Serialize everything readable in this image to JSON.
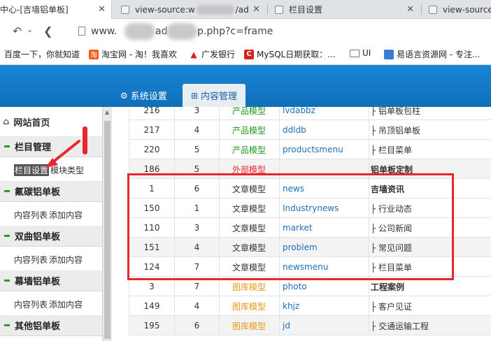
{
  "browser": {
    "tabs": [
      {
        "label": "中心-[吉墙铝单板]",
        "active": true
      },
      {
        "label": "view-source:w",
        "tail": "/ad"
      },
      {
        "label": "栏目设置"
      },
      {
        "label": "view-source:"
      }
    ],
    "address": {
      "prefix": "www.",
      "mid": "ad",
      "suffix": "p.php?c=frame"
    },
    "bookmarks": [
      {
        "label": "百度一下，你就知道"
      },
      {
        "label": "淘宝网 - 淘！我喜欢",
        "icon_text": "淘"
      },
      {
        "label": "广发银行"
      },
      {
        "label": "MySQL日期获取：...",
        "icon_text": "C"
      },
      {
        "label": "UI"
      },
      {
        "label": "易语言资源网 - 专注..."
      }
    ]
  },
  "app": {
    "topnav": [
      {
        "label": "系统设置",
        "icon": "⚙"
      },
      {
        "label": "内容管理",
        "icon": "⊞",
        "active": true
      }
    ],
    "sidebar": {
      "home": "网站首页",
      "groups": [
        {
          "title": "栏目管理",
          "subs": [
            "栏目设置",
            "模块类型"
          ]
        },
        {
          "title": "氟碳铝单板",
          "subs": [
            "内容列表",
            "添加内容"
          ]
        },
        {
          "title": "双曲铝单板",
          "subs": [
            "内容列表",
            "添加内容"
          ]
        },
        {
          "title": "幕墙铝单板",
          "subs": [
            "内容列表",
            "添加内容"
          ]
        },
        {
          "title": "其他铝单板",
          "subs": []
        }
      ]
    },
    "table": {
      "rows": [
        {
          "id": "216",
          "order": "3",
          "model": "产品模型",
          "model_color": "green",
          "dir": "lvdabbz",
          "name": "├ 铝单板包柱",
          "bold": false
        },
        {
          "id": "217",
          "order": "4",
          "model": "产品模型",
          "model_color": "green",
          "dir": "ddldb",
          "name": "├ 吊顶铝单板",
          "bold": false
        },
        {
          "id": "220",
          "order": "5",
          "model": "产品模型",
          "model_color": "green",
          "dir": "productsmenu",
          "name": "├ 栏目菜单",
          "bold": false
        },
        {
          "id": "186",
          "order": "5",
          "model": "外部模型",
          "model_color": "red",
          "dir": "",
          "name": "铝单板定制",
          "bold": true
        },
        {
          "id": "1",
          "order": "6",
          "model": "文章模型",
          "model_color": "plain",
          "dir": "news",
          "name": "吉墙资讯",
          "bold": true
        },
        {
          "id": "150",
          "order": "1",
          "model": "文章模型",
          "model_color": "plain",
          "dir": "Industrynews",
          "name": "├ 行业动态",
          "bold": false
        },
        {
          "id": "110",
          "order": "3",
          "model": "文章模型",
          "model_color": "plain",
          "dir": "market",
          "name": "├ 公司新闻",
          "bold": false
        },
        {
          "id": "151",
          "order": "4",
          "model": "文章模型",
          "model_color": "plain",
          "dir": "problem",
          "name": "├ 常见问题",
          "bold": false
        },
        {
          "id": "124",
          "order": "7",
          "model": "文章模型",
          "model_color": "plain",
          "dir": "newsmenu",
          "name": "├ 栏目菜单",
          "bold": false
        },
        {
          "id": "3",
          "order": "7",
          "model": "图库模型",
          "model_color": "orange",
          "dir": "photo",
          "name": "工程案例",
          "bold": true
        },
        {
          "id": "149",
          "order": "4",
          "model": "图库模型",
          "model_color": "orange",
          "dir": "khjz",
          "name": "├ 客户见证",
          "bold": false
        },
        {
          "id": "195",
          "order": "6",
          "model": "图库模型",
          "model_color": "orange",
          "dir": "jd",
          "name": "├ 交通运输工程",
          "bold": false
        }
      ]
    }
  },
  "colors": {
    "accent": "#1a86d6",
    "annotation": "#e8262d",
    "link": "#1e6eb9"
  }
}
